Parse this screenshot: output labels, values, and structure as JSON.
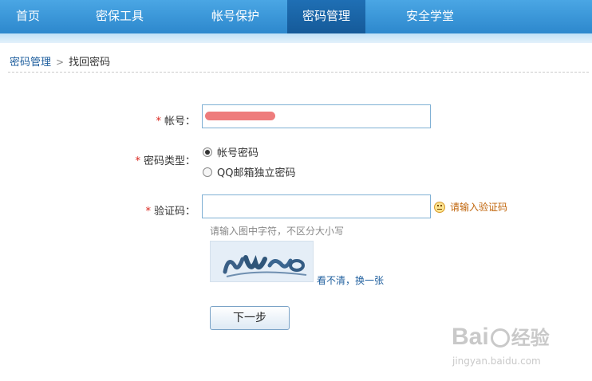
{
  "nav": {
    "items": [
      {
        "label": "首页"
      },
      {
        "label": "密保工具"
      },
      {
        "label": "帐号保护"
      },
      {
        "label": "密码管理",
        "active": true
      },
      {
        "label": "安全学堂"
      }
    ]
  },
  "breadcrumb": {
    "parent": "密码管理",
    "current": "找回密码"
  },
  "form": {
    "required_mark": "*",
    "account_label": "帐号：",
    "type_label": "密码类型：",
    "type_options": [
      "帐号密码",
      "QQ邮箱独立密码"
    ],
    "type_selected_index": 0,
    "captcha_label": "验证码：",
    "captcha_warning": "请输入验证码",
    "captcha_hint": "请输入图中字符，不区分大小写",
    "captcha_refresh": "看不清，换一张",
    "next_button": "下一步"
  },
  "watermark": {
    "brand": "Bai",
    "brand_tail": "经验",
    "url": "jingyan.baidu.com"
  },
  "colors": {
    "nav_bg": "#2d88cd",
    "nav_active": "#155a99",
    "required": "#d9251c",
    "link": "#1f5f9e",
    "warning": "#c0640a"
  }
}
